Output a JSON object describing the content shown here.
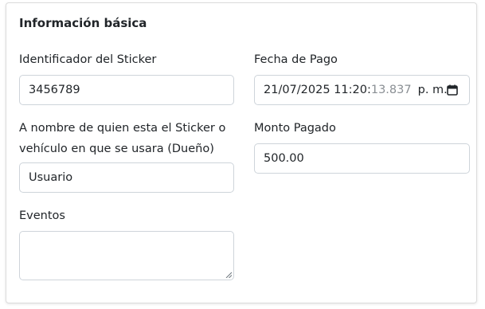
{
  "section": {
    "title": "Información básica"
  },
  "fields": {
    "sticker_id": {
      "label": "Identificador del Sticker",
      "value": "3456789"
    },
    "owner": {
      "label_line1": "A nombre de quien esta el Sticker o",
      "label_line2": "vehículo en que se usara (Dueño)",
      "value": "Usuario"
    },
    "events": {
      "label": "Eventos",
      "value": ""
    },
    "payment_date": {
      "label": "Fecha de Pago",
      "value_main": "21/07/2025 11:20:",
      "value_seconds": "13.837",
      "value_ampm": "p. m."
    },
    "amount_paid": {
      "label": "Monto Pagado",
      "value": "500.00"
    }
  },
  "icons": {
    "calendar": "calendar-icon",
    "resize": "resize-handle-icon"
  },
  "colors": {
    "border": "#ced4da",
    "text": "#212529",
    "muted": "#8a8f94"
  }
}
